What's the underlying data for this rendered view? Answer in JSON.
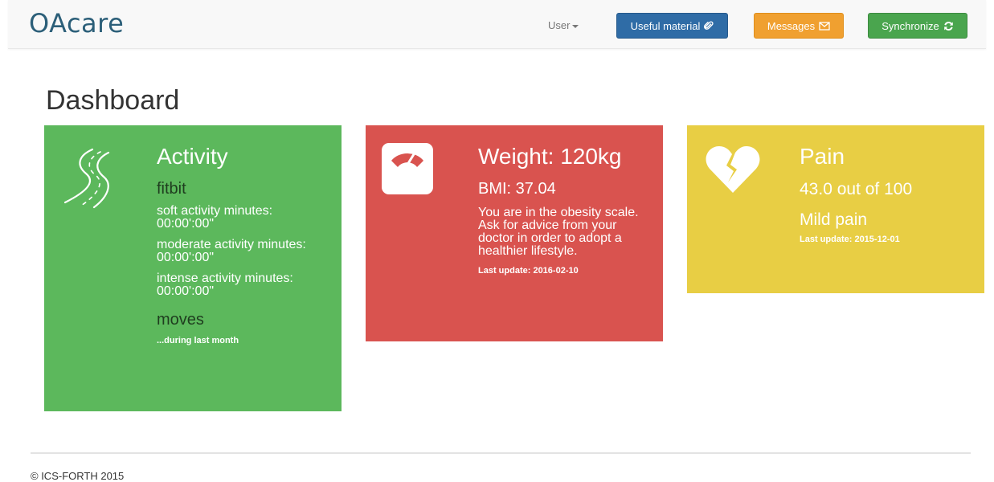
{
  "brand": "OAcare",
  "nav": {
    "user_label": "User",
    "material_label": "Useful material",
    "messages_label": "Messages",
    "sync_label": "Synchronize"
  },
  "page_title": "Dashboard",
  "activity": {
    "title": "Activity",
    "source1": "fitbit",
    "soft": "soft activity minutes: 00:00':00\"",
    "moderate": "moderate activity minutes: 00:00':00\"",
    "intense": "intense activity minutes: 00:00':00\"",
    "source2": "moves",
    "note": "...during last month"
  },
  "weight": {
    "title": "Weight: 120kg",
    "bmi": "BMI: 37.04",
    "advice": "You are in the obesity scale. Ask for advice from your doctor in order to adopt a healthier lifestyle.",
    "last_update": "Last update: 2016-02-10"
  },
  "pain": {
    "title": "Pain",
    "score": "43.0 out of 100",
    "level": "Mild pain",
    "last_update": "Last update: 2015-12-01"
  },
  "footer": "© ICS-FORTH 2015",
  "colors": {
    "activity": "#5cb85c",
    "weight": "#d9534f",
    "pain": "#e8ce44",
    "material": "#2f6ca6",
    "messages": "#f0a030",
    "sync": "#4aa54e"
  }
}
